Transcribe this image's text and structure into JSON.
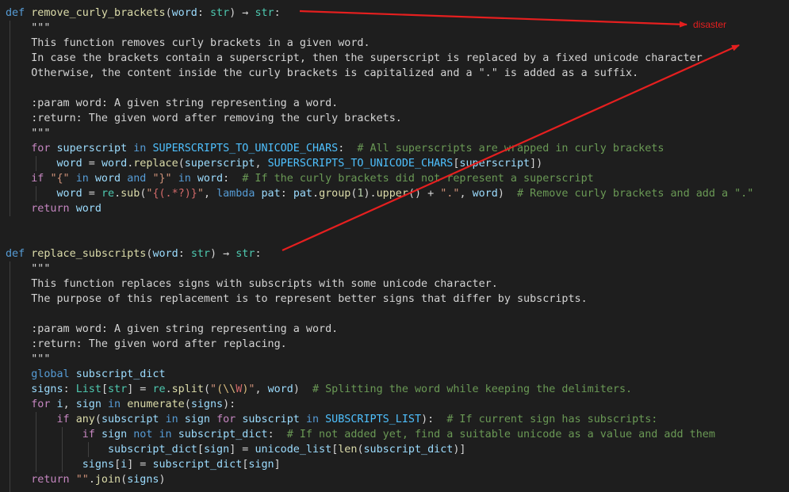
{
  "annotation": {
    "label": "disaster",
    "color": "#e51f1f"
  },
  "code": {
    "l1": [
      "def",
      "remove_curly_brackets",
      "(",
      "word",
      ": ",
      "str",
      ") → ",
      "str",
      ":"
    ],
    "l2": "\"\"\"",
    "l3": "This function removes curly brackets in a given word.",
    "l4": "In case the brackets contain a superscript, then the superscript is replaced by a fixed unicode character.",
    "l5": "Otherwise, the content inside the curly brackets is capitalized and a \".\" is added as a suffix.",
    "l7": ":param word: A given string representing a word.",
    "l8": ":return: The given word after removing the curly brackets.",
    "l9": "\"\"\"",
    "l10": [
      "for",
      "superscript",
      "in",
      "SUPERSCRIPTS_TO_UNICODE_CHARS",
      ":  ",
      "# All superscripts are wrapped in curly brackets"
    ],
    "l11": [
      "word",
      " = ",
      "word",
      ".",
      "replace",
      "(",
      "superscript",
      ", ",
      "SUPERSCRIPTS_TO_UNICODE_CHARS",
      "[",
      "superscript",
      "])"
    ],
    "l12": [
      "if",
      "\"{\"",
      "in",
      "word",
      "and",
      "\"}\"",
      "in",
      "word",
      ":  ",
      "# If the curly brackets did not represent a superscript"
    ],
    "l13": [
      "word",
      " = ",
      "re",
      ".",
      "sub",
      "(",
      "\"",
      "{(.*?)}",
      "\"",
      ", ",
      "lambda",
      "pat",
      ": ",
      "pat",
      ".",
      "group",
      "(",
      "1",
      ").",
      "upper",
      "() + ",
      "\".\"",
      ", ",
      "word",
      ")  ",
      "# Remove curly brackets and add a \".\""
    ],
    "l14": [
      "return",
      "word"
    ],
    "l17": [
      "def",
      "replace_subscripts",
      "(",
      "word",
      ": ",
      "str",
      ") → ",
      "str",
      ":"
    ],
    "l18": "\"\"\"",
    "l19": "This function replaces signs with subscripts with some unicode character.",
    "l20": "The purpose of this replacement is to represent better signs that differ by subscripts.",
    "l22": ":param word: A given string representing a word.",
    "l23": ":return: The given word after replacing.",
    "l24": "\"\"\"",
    "l25": [
      "global",
      "subscript_dict"
    ],
    "l26": [
      "signs",
      ": ",
      "List",
      "[",
      "str",
      "] = ",
      "re",
      ".",
      "split",
      "(",
      "\"",
      "(",
      "\\\\",
      "W",
      ")",
      "\"",
      ", ",
      "word",
      ")  ",
      "# Splitting the word while keeping the delimiters."
    ],
    "l27": [
      "for",
      "i",
      ", ",
      "sign",
      "in",
      "enumerate",
      "(",
      "signs",
      "):"
    ],
    "l28": [
      "if",
      "any",
      "(",
      "subscript",
      "in",
      "sign",
      "for",
      "subscript",
      "in",
      "SUBSCRIPTS_LIST",
      "):  ",
      "# If current sign has subscripts:"
    ],
    "l29": [
      "if",
      "sign",
      "not",
      "in",
      "subscript_dict",
      ":  ",
      "# If not added yet, find a suitable unicode as a value and add them"
    ],
    "l30": [
      "subscript_dict",
      "[",
      "sign",
      "] = ",
      "unicode_list",
      "[",
      "len",
      "(",
      "subscript_dict",
      ")]"
    ],
    "l31": [
      "signs",
      "[",
      "i",
      "] = ",
      "subscript_dict",
      "[",
      "sign",
      "]"
    ],
    "l32": [
      "return",
      "\"\"",
      ".",
      "join",
      "(",
      "signs",
      ")"
    ]
  }
}
